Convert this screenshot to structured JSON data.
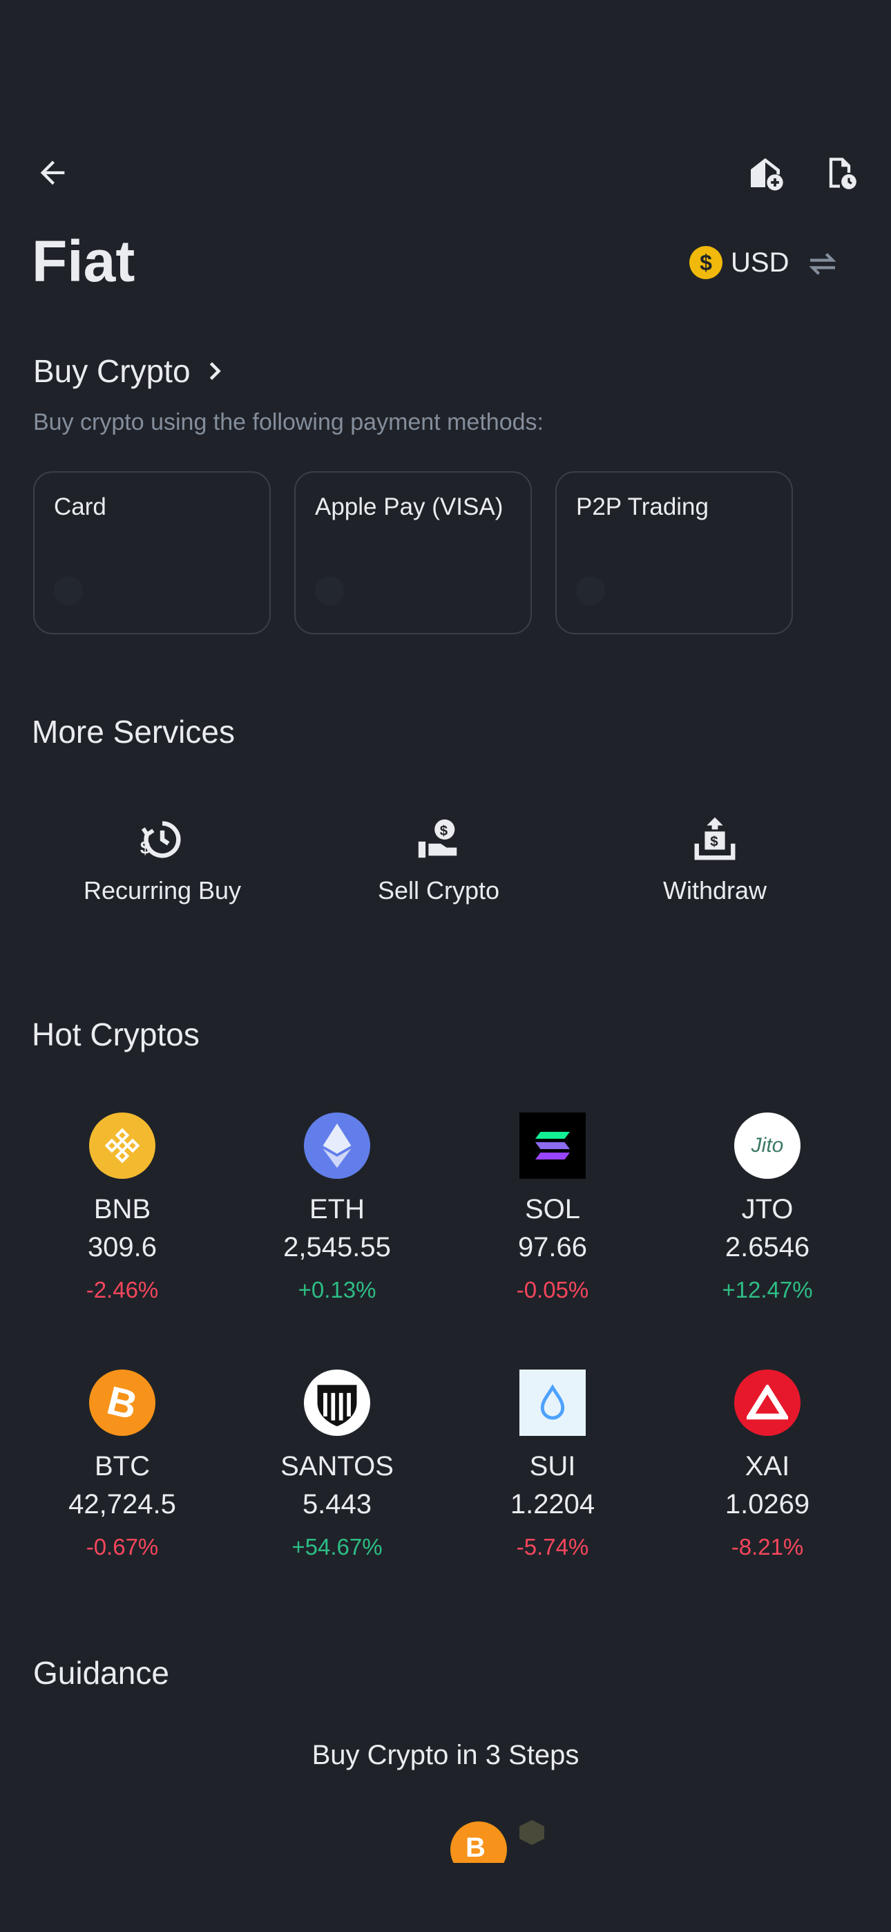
{
  "header": {
    "back_icon": "arrow-left-icon",
    "home_icon": "home-add-icon",
    "history_icon": "document-clock-icon"
  },
  "page": {
    "title": "Fiat",
    "currency": "USD",
    "currency_icon": "dollar-coin-icon",
    "swap_icon": "swap-arrows-icon"
  },
  "buy_crypto": {
    "title": "Buy Crypto",
    "subtitle": "Buy crypto using the following payment methods:",
    "methods": [
      {
        "label": "Card"
      },
      {
        "label": "Apple Pay (VISA)"
      },
      {
        "label": "P2P Trading"
      }
    ]
  },
  "more_services": {
    "title": "More Services",
    "items": [
      {
        "label": "Recurring Buy",
        "icon": "recurring-dollar-icon"
      },
      {
        "label": "Sell Crypto",
        "icon": "hand-dollar-icon"
      },
      {
        "label": "Withdraw",
        "icon": "withdraw-icon"
      }
    ]
  },
  "hot_cryptos": {
    "title": "Hot Cryptos",
    "coins": [
      {
        "symbol": "BNB",
        "price": "309.6",
        "change": "-2.46%",
        "direction": "down",
        "color": "#f3ba2f"
      },
      {
        "symbol": "ETH",
        "price": "2,545.55",
        "change": "+0.13%",
        "direction": "up",
        "color": "#627eea"
      },
      {
        "symbol": "SOL",
        "price": "97.66",
        "change": "-0.05%",
        "direction": "down",
        "color": "#000000"
      },
      {
        "symbol": "JTO",
        "price": "2.6546",
        "change": "+12.47%",
        "direction": "up",
        "color": "#ffffff"
      },
      {
        "symbol": "BTC",
        "price": "42,724.5",
        "change": "-0.67%",
        "direction": "down",
        "color": "#f7931a"
      },
      {
        "symbol": "SANTOS",
        "price": "5.443",
        "change": "+54.67%",
        "direction": "up",
        "color": "#ffffff"
      },
      {
        "symbol": "SUI",
        "price": "1.2204",
        "change": "-5.74%",
        "direction": "down",
        "color": "#e8f4fc"
      },
      {
        "symbol": "XAI",
        "price": "1.0269",
        "change": "-8.21%",
        "direction": "down",
        "color": "#e8182c"
      }
    ]
  },
  "guidance": {
    "title": "Guidance",
    "card_title": "Buy Crypto in 3 Steps"
  },
  "colors": {
    "background": "#1f2329",
    "up": "#2ebd85",
    "down": "#f6465d",
    "accent": "#f0b90b"
  }
}
